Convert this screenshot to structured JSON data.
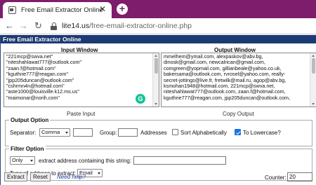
{
  "browser": {
    "tab_title": "Free Email Extractor Online",
    "tab_close": "✕",
    "new_tab": "+",
    "url_host": "lite14.us",
    "url_path": "/free-email-extractor-online.php"
  },
  "app": {
    "title": "Free Email Extractor Online",
    "input_label": "Input Window",
    "output_label": "Output Window",
    "input_lines": [
      "\"221mcp@swva.net\"",
      "\"niteshahlawat777@outlook.com\"",
      "\"zaan.f@hotmail.com\"",
      "\"kguthrie777@reagan.com\"",
      "\"jpp205duncan@outlook.com\"",
      "\"cshrmn4n@hotmail.com\"",
      "\"aste1000@louisville.k12.ms.us\"",
      "\"maimonar@norih.com\""
    ],
    "output_lines": [
      "mmelhem@ymail.com, alexpaskov@abv.bg,",
      "dinosk@gmail.com, newcalrican@gmail.com,",
      "comgreen@yopmail.com, gillianbeale@yahoo.co.uk,",
      "bakersama@outlook.com, rvrosel@yahoo.com, really-",
      "secret-jottings@live.fr, fretwilk@mail.ru, agop@abv.bg,",
      "ksmohan1948@hotmail.com, 221mcp@swva.net,",
      "niteshahlawat777@outlook.com, zaan.f@hotmail.com,",
      "kguthrie777@reagan.com, jpp205duncan@outlook.com,"
    ],
    "grammarly": "G",
    "paste_label": "Paste Input",
    "copy_label": "Copy Output"
  },
  "output_option": {
    "legend": "Output Option",
    "separator_label": "Separator:",
    "separator_value": "Comma",
    "separator_custom": "",
    "group_label": "Group:",
    "group_value": "",
    "addresses_label": "Addresses",
    "sort_label": "Sort Alphabetically",
    "sort_checked": false,
    "lowercase_label": "To Lowercase?",
    "lowercase_checked": true
  },
  "filter_option": {
    "legend": "Filter Option",
    "mode_value": "Only",
    "contain_label": "extract address containing this string:",
    "contain_value": "",
    "type_label": "Type of address to extract:",
    "type_value": "Email"
  },
  "footer": {
    "extract_label": "Extract",
    "reset_label": "Reset",
    "help_label": "Need help?",
    "counter_label": "Counter:",
    "counter_value": "20"
  }
}
